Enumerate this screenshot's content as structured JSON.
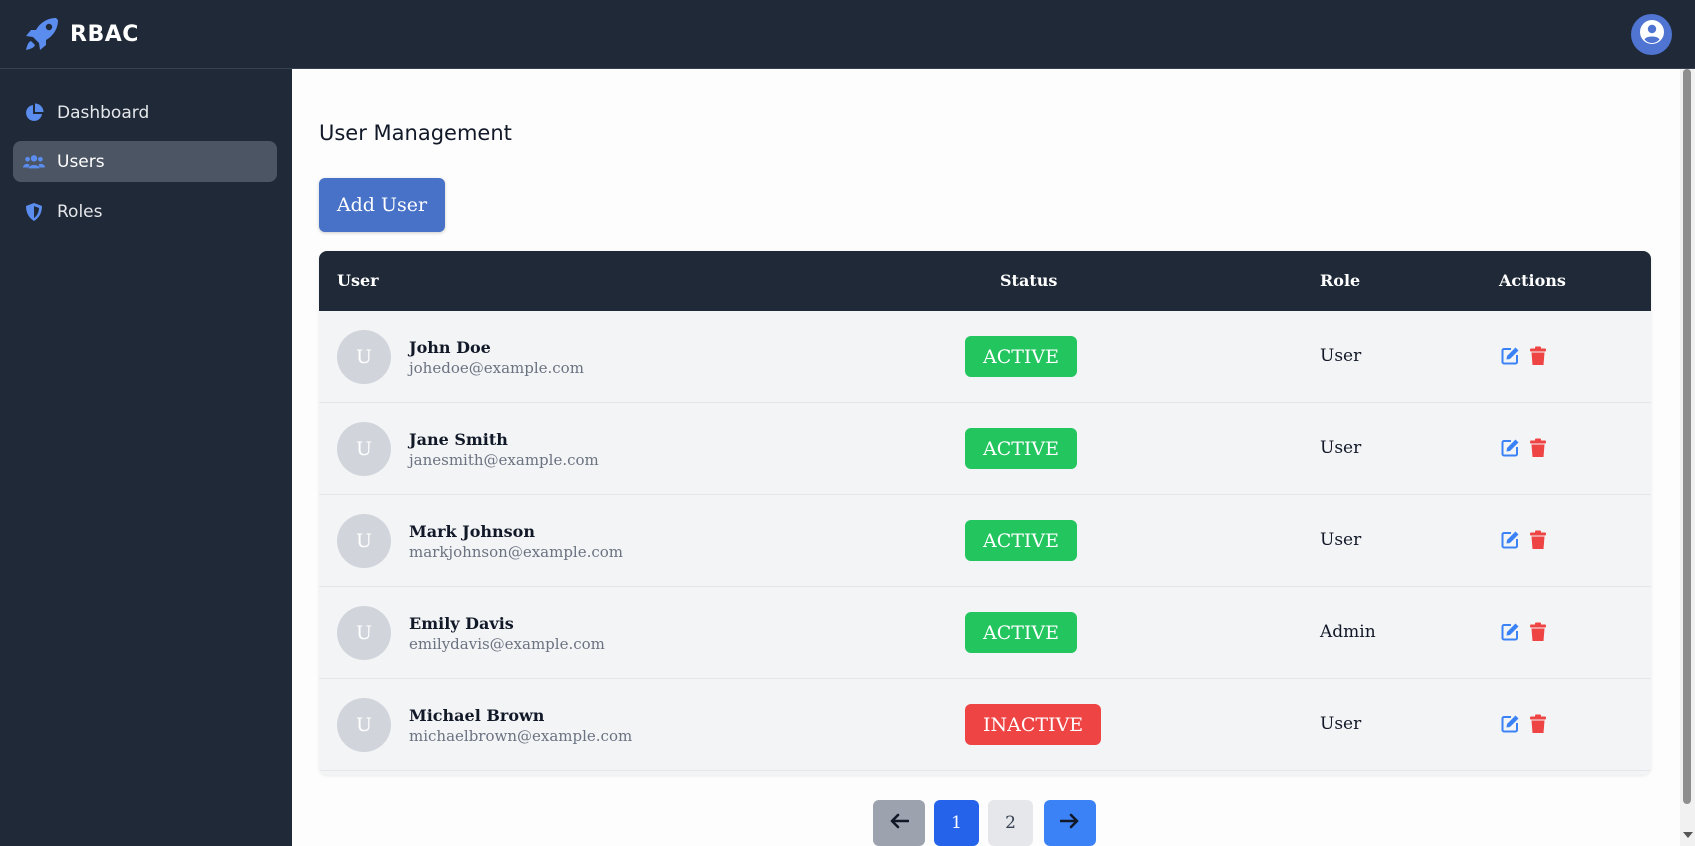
{
  "app": {
    "name": "RBAC",
    "logo_icon": "rocket-icon",
    "user_icon": "user-circle-icon"
  },
  "sidebar": {
    "items": [
      {
        "label": "Dashboard",
        "icon": "pie-chart-icon",
        "active": false
      },
      {
        "label": "Users",
        "icon": "users-icon",
        "active": true
      },
      {
        "label": "Roles",
        "icon": "shield-icon",
        "active": false
      }
    ]
  },
  "page": {
    "title": "User Management",
    "add_button": "Add User"
  },
  "table": {
    "headers": {
      "user": "User",
      "status": "Status",
      "role": "Role",
      "actions": "Actions"
    },
    "rows": [
      {
        "initial": "U",
        "name": "John Doe",
        "email": "johedoe@example.com",
        "status": "ACTIVE",
        "role": "User"
      },
      {
        "initial": "U",
        "name": "Jane Smith",
        "email": "janesmith@example.com",
        "status": "ACTIVE",
        "role": "User"
      },
      {
        "initial": "U",
        "name": "Mark Johnson",
        "email": "markjohnson@example.com",
        "status": "ACTIVE",
        "role": "User"
      },
      {
        "initial": "U",
        "name": "Emily Davis",
        "email": "emilydavis@example.com",
        "status": "ACTIVE",
        "role": "Admin"
      },
      {
        "initial": "U",
        "name": "Michael Brown",
        "email": "michaelbrown@example.com",
        "status": "INACTIVE",
        "role": "User"
      }
    ]
  },
  "pagination": {
    "pages": [
      "1",
      "2"
    ],
    "current": "1",
    "prev_icon": "arrow-left-icon",
    "next_icon": "arrow-right-icon"
  },
  "colors": {
    "nav_bg": "#1f2937",
    "accent": "#4772c8",
    "active": "#22c55e",
    "inactive": "#ef4444",
    "edit": "#3b82f6",
    "delete": "#ef4444"
  }
}
